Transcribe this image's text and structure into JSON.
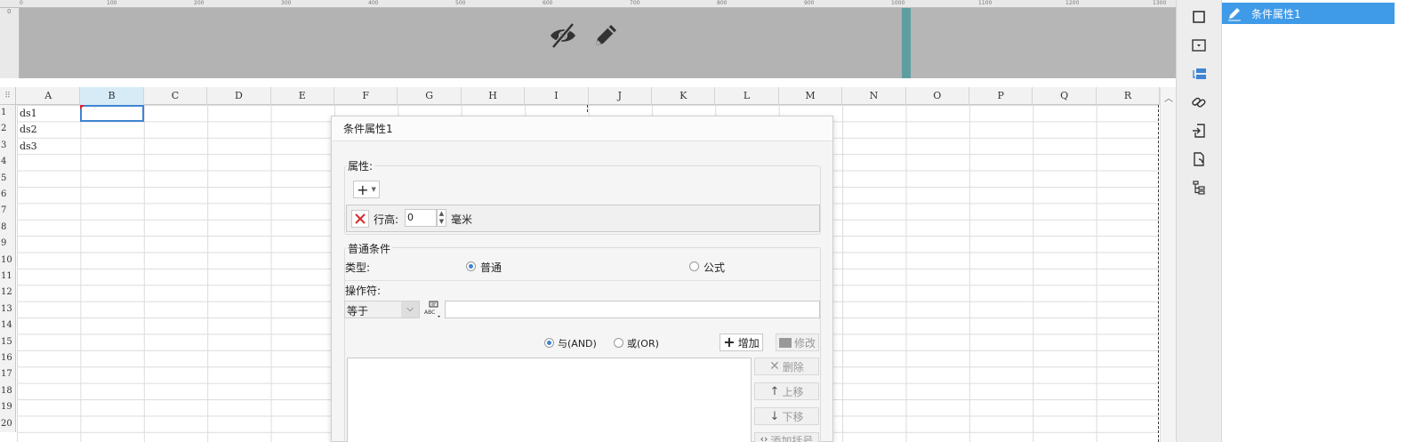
{
  "ruler": {
    "ticks": [
      "0",
      "100",
      "200",
      "300",
      "400",
      "500",
      "600",
      "700",
      "800",
      "900",
      "1000",
      "1100",
      "1200",
      "1300"
    ]
  },
  "vruler": {
    "label": "0"
  },
  "preview": {
    "icons": [
      "eye-slash-icon",
      "pencil-icon"
    ]
  },
  "sheet": {
    "columns": [
      "A",
      "B",
      "C",
      "D",
      "E",
      "F",
      "G",
      "H",
      "I",
      "J",
      "K",
      "L",
      "M",
      "N",
      "O",
      "P",
      "Q",
      "R"
    ],
    "selected_column": "B",
    "rows": [
      "1",
      "2",
      "3",
      "4",
      "5",
      "6",
      "7",
      "8",
      "9",
      "10",
      "11",
      "12",
      "13",
      "14",
      "15",
      "16",
      "17",
      "18",
      "19",
      "20"
    ],
    "cells": [
      {
        "ref": "A1",
        "value": "ds1"
      },
      {
        "ref": "A2",
        "value": "ds2"
      },
      {
        "ref": "A3",
        "value": "ds3"
      }
    ],
    "selected_cell": "B1"
  },
  "right_toolbar": {
    "buttons": [
      "cell-element-icon",
      "cell-attribute-icon",
      "condition-attribute-icon",
      "hyperlink-icon",
      "import-icon",
      "widget-icon",
      "tree-icon"
    ],
    "active": "condition-attribute-icon"
  },
  "right_panel": {
    "items": [
      {
        "label": "条件属性1",
        "icon": "pencil-icon"
      }
    ]
  },
  "dialog": {
    "title": "条件属性1",
    "attribute_group": {
      "label": "属性:",
      "add_label": "+",
      "row_height_label": "行高:",
      "row_height_value": "0",
      "unit": "毫米"
    },
    "condition_group": {
      "label": "普通条件",
      "type_label": "类型:",
      "type_options": [
        "普通",
        "公式"
      ],
      "type_selected": "普通",
      "operator_label": "操作符:",
      "operator_value": "等于",
      "operator_input": "",
      "logic_options": [
        "与(AND)",
        "或(OR)"
      ],
      "logic_selected": "与(AND)",
      "add_button": "增加",
      "modify_button": "修改",
      "delete_button": "删除",
      "move_up_button": "上移",
      "move_down_button": "下移",
      "add_bracket_button": "添加括号"
    }
  }
}
